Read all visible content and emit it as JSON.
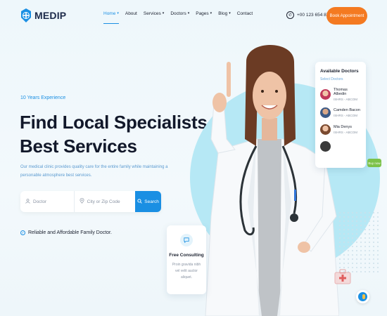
{
  "brand": {
    "name": "MEDIP"
  },
  "nav": {
    "items": [
      {
        "label": "Home",
        "active": true,
        "has_dropdown": true
      },
      {
        "label": "About",
        "active": false,
        "has_dropdown": false
      },
      {
        "label": "Services",
        "active": false,
        "has_dropdown": true
      },
      {
        "label": "Doctors",
        "active": false,
        "has_dropdown": true
      },
      {
        "label": "Pages",
        "active": false,
        "has_dropdown": true
      },
      {
        "label": "Blog",
        "active": false,
        "has_dropdown": true
      },
      {
        "label": "Contact",
        "active": false,
        "has_dropdown": false
      }
    ]
  },
  "header": {
    "phone": "+00 123 654 878",
    "cta_label": "Book Appointment"
  },
  "hero": {
    "experience": "10 Years Experience",
    "title_line1": "Find Local Specialists",
    "title_line2": "Best Services",
    "description": "Our medical clinic provides quality care for the entire family while maintaining a personable atmosphere best services.",
    "reliable": "Reliable and Affordable Family Doctor."
  },
  "search": {
    "doctor_placeholder": "Doctor",
    "zip_placeholder": "City or Zip Code",
    "button_label": "Search"
  },
  "available_doctors": {
    "title": "Available Doctors",
    "subtitle": "Select Doctors",
    "doctors": [
      {
        "name": "Thomas Albedin",
        "spec": "ISHRS - ABCOM"
      },
      {
        "name": "Camden Bacon",
        "spec": "ISHRS - ABCOM"
      },
      {
        "name": "Mia Denys",
        "spec": "ISHRS - ABCOM"
      }
    ]
  },
  "buy_now": {
    "label": "Buy now"
  },
  "consulting": {
    "title": "Free Consulting",
    "text": "Proin gravida nibh vel velit auctor aliquet."
  },
  "colors": {
    "accent": "#1a8fe3",
    "cta": "#f47a21",
    "circle": "#b6e8f5",
    "buy": "#7cc24a"
  },
  "icons": {
    "logo": "globe-cross-icon",
    "phone": "phone-icon",
    "doctor_field": "user-icon",
    "zip_field": "location-pin-icon",
    "search": "search-icon",
    "reliable": "check-circle-icon",
    "consulting": "chat-icon",
    "toggle": "scroll-toggle-icon"
  }
}
